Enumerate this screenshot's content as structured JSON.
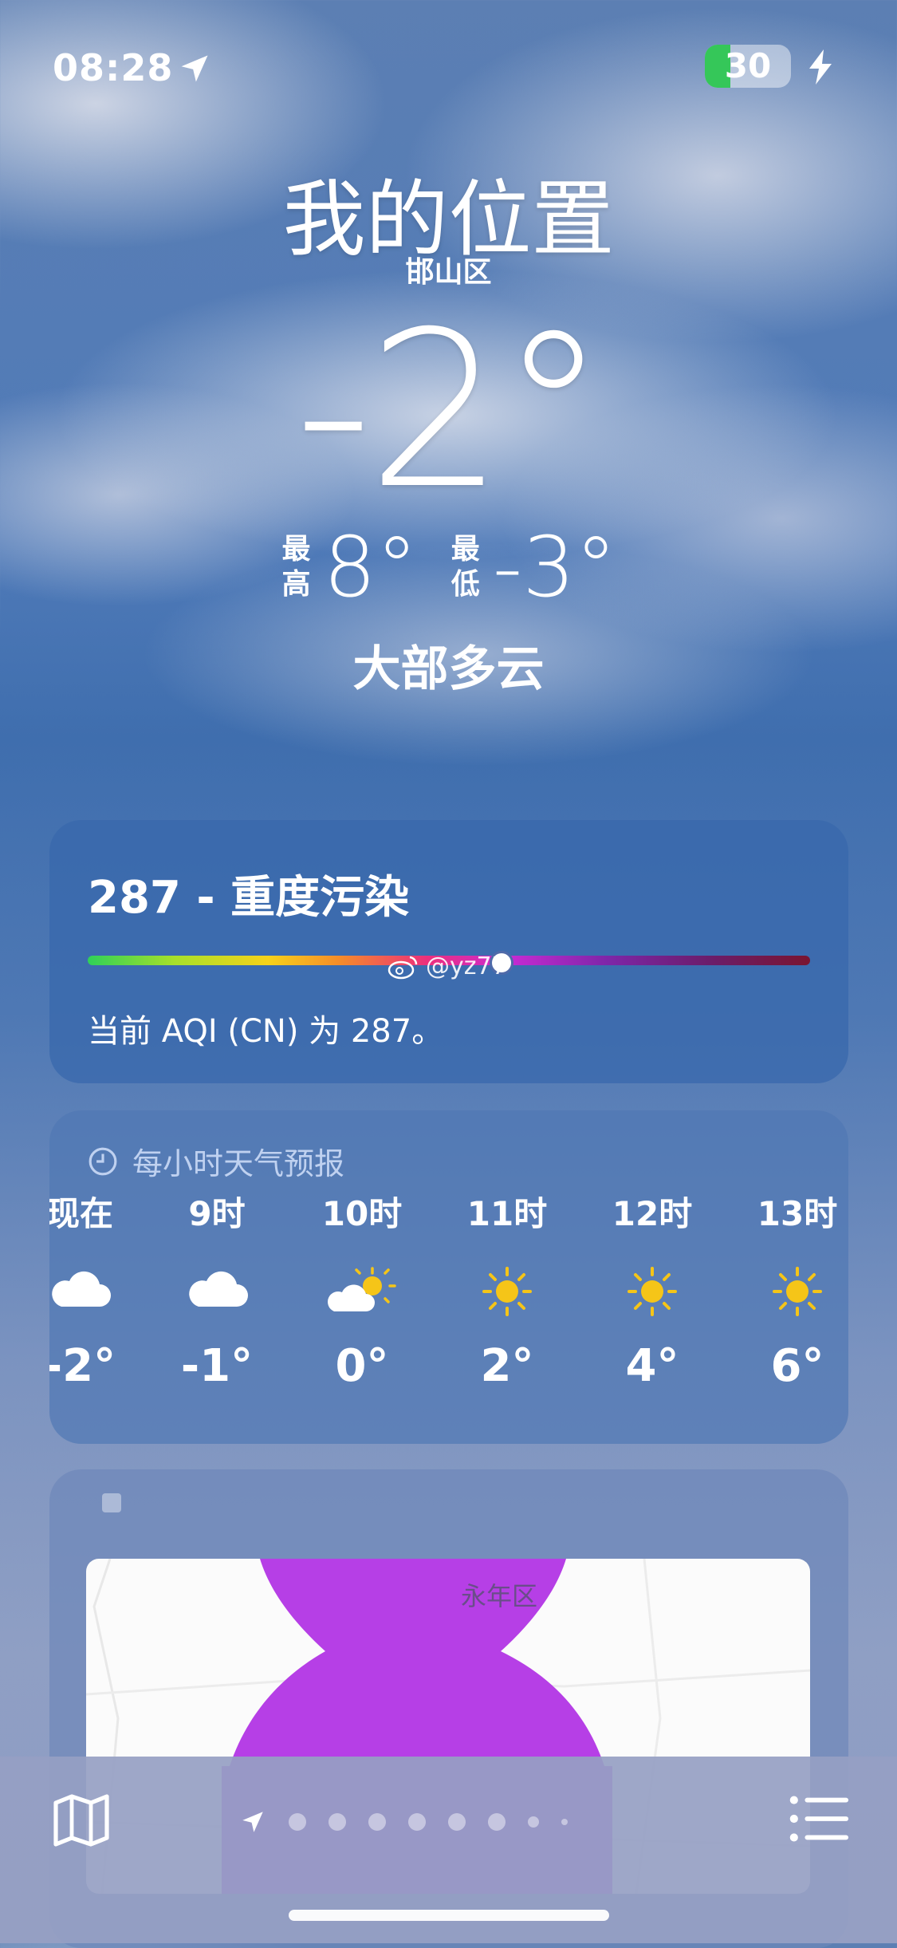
{
  "status_bar": {
    "time": "08:28",
    "battery_level": "30",
    "battery_fraction": 0.3,
    "charging": true,
    "icons": [
      "location-arrow-icon",
      "battery-icon",
      "charging-bolt-icon"
    ]
  },
  "hero": {
    "location": "我的位置",
    "district": "邯山区",
    "current_temp": "-2°",
    "high_label": "最高",
    "high": "8°",
    "low_label": "最低",
    "low": "-3°",
    "condition": "大部多云"
  },
  "aqi": {
    "title": "287 - 重度污染",
    "value": 287,
    "scale_position": 0.57,
    "watermark": "@yz77",
    "description": "当前 AQI (CN) 为 287。",
    "colors": [
      "#2fd158",
      "#f7d21a",
      "#ec2f7c",
      "#c82bd4",
      "#7a1530"
    ]
  },
  "hourly": {
    "header": "每小时天气预报",
    "items": [
      {
        "time": "现在",
        "icon": "cloud-icon",
        "temp": "-2°"
      },
      {
        "time": "9时",
        "icon": "cloud-icon",
        "temp": "-1°"
      },
      {
        "time": "10时",
        "icon": "partly-sunny-icon",
        "temp": "0°"
      },
      {
        "time": "11时",
        "icon": "sun-icon",
        "temp": "2°"
      },
      {
        "time": "12时",
        "icon": "sun-icon",
        "temp": "4°"
      },
      {
        "time": "13时",
        "icon": "sun-icon",
        "temp": "6°"
      }
    ]
  },
  "map": {
    "area_label": "永年区",
    "overlay_color": "#b63fe6"
  },
  "toolbar": {
    "icons": [
      "map-icon",
      "location-arrow-icon",
      "list-icon"
    ],
    "page_count": 9,
    "current_page": 0
  }
}
